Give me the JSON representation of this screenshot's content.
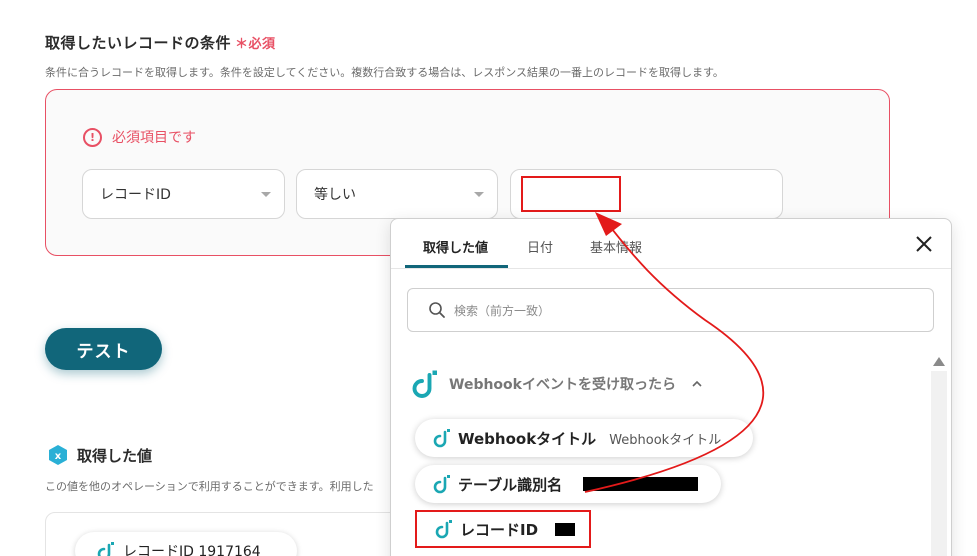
{
  "section": {
    "title": "取得したいレコードの条件",
    "required": "＊必須",
    "description": "条件に合うレコードを取得します。条件を設定してください。複数行合致する場合は、レスポンス結果の一番上のレコードを取得します。"
  },
  "condition": {
    "error_text": "必須項目です",
    "field_select": "レコードID",
    "operator_select": "等しい",
    "value": ""
  },
  "test_button": "テスト",
  "retrieved": {
    "title": "取得した値",
    "description": "この値を他のオペレーションで利用することができます。利用した",
    "chip": "レコードID 1917164"
  },
  "popup": {
    "tabs": [
      "取得した値",
      "日付",
      "基本情報"
    ],
    "active_tab": "取得した値",
    "search_placeholder": "検索（前方一致）",
    "group_label": "Webhookイベントを受け取ったら",
    "items": [
      {
        "label": "Webhookタイトル",
        "value": "Webhookタイトル"
      },
      {
        "label": "テーブル識別名",
        "value": ""
      },
      {
        "label": "レコードID",
        "value": ""
      }
    ]
  },
  "colors": {
    "accent": "#11667a",
    "error": "#e85064",
    "annotation_red": "#e31a1a",
    "brand_teal": "#1aa7b3"
  }
}
